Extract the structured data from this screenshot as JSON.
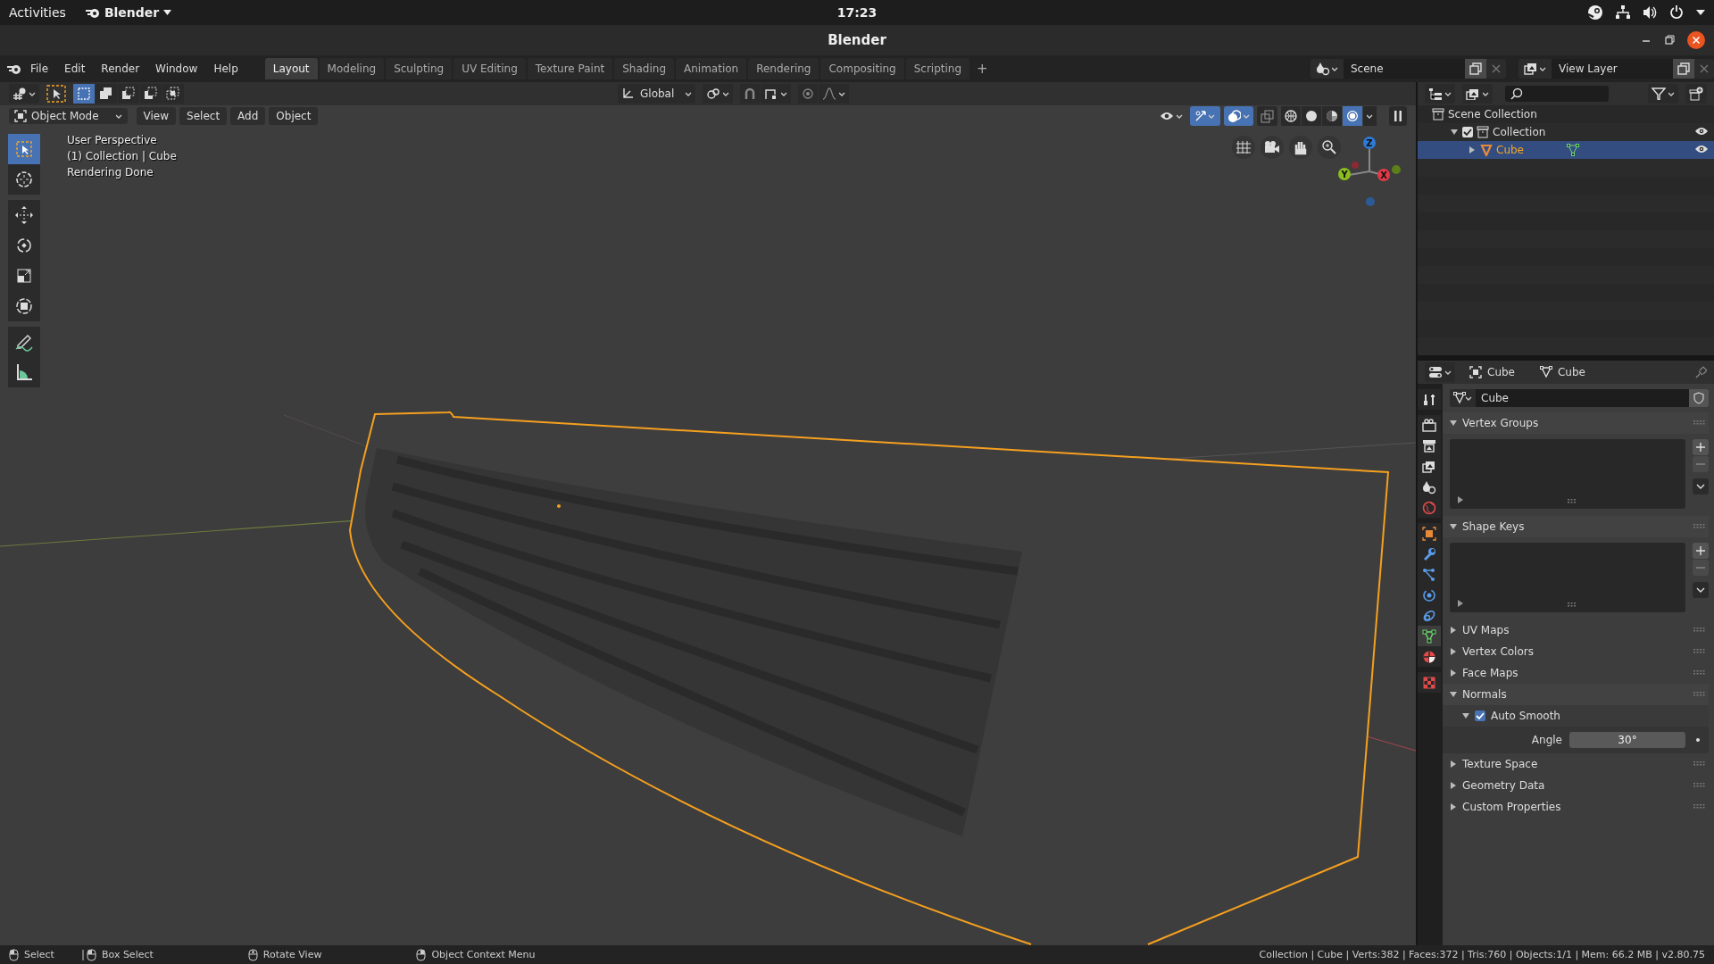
{
  "system_bar": {
    "activities": "Activities",
    "app": "Blender",
    "clock": "17:23"
  },
  "window": {
    "title": "Blender"
  },
  "menu": [
    "File",
    "Edit",
    "Render",
    "Window",
    "Help"
  ],
  "workspaces": [
    {
      "label": "Layout",
      "selected": true
    },
    {
      "label": "Modeling",
      "selected": false
    },
    {
      "label": "Sculpting",
      "selected": false
    },
    {
      "label": "UV Editing",
      "selected": false
    },
    {
      "label": "Texture Paint",
      "selected": false
    },
    {
      "label": "Shading",
      "selected": false
    },
    {
      "label": "Animation",
      "selected": false
    },
    {
      "label": "Rendering",
      "selected": false
    },
    {
      "label": "Compositing",
      "selected": false
    },
    {
      "label": "Scripting",
      "selected": false
    }
  ],
  "add_workspace": "+",
  "scene_field": "Scene",
  "view_layer_field": "View Layer",
  "tool_header": {
    "select_modes": [
      {
        "kind": "set",
        "selected": true
      },
      {
        "kind": "extend",
        "selected": false
      },
      {
        "kind": "subtract",
        "selected": false
      },
      {
        "kind": "invert",
        "selected": false
      },
      {
        "kind": "intersect",
        "selected": false
      }
    ],
    "orientation": "Global"
  },
  "viewport_header": {
    "mode": "Object Mode",
    "menus": [
      "View",
      "Select",
      "Add",
      "Object"
    ],
    "toggles": [
      {
        "kind": "gizmos",
        "on": true
      },
      {
        "kind": "overlays",
        "on": true
      },
      {
        "kind": "xray",
        "on": false
      }
    ],
    "shading": [
      {
        "kind": "wireframe",
        "selected": false
      },
      {
        "kind": "solid",
        "selected": false
      },
      {
        "kind": "material",
        "selected": false
      },
      {
        "kind": "rendered",
        "selected": true
      }
    ]
  },
  "viewport_info": [
    "User Perspective",
    "(1) Collection | Cube",
    "Rendering Done"
  ],
  "gizmo_axes": [
    "Z",
    "Y",
    "X"
  ],
  "toolbar": [
    {
      "kind": "select",
      "selected": true
    },
    {
      "kind": "cursor",
      "selected": false
    },
    {
      "kind": "move",
      "selected": false
    },
    {
      "kind": "rotate",
      "selected": false
    },
    {
      "kind": "scale",
      "selected": false
    },
    {
      "kind": "transform",
      "selected": false
    },
    {
      "kind": "annotate",
      "selected": false
    },
    {
      "kind": "measure",
      "selected": false
    }
  ],
  "outliner": {
    "tree": [
      {
        "label": "Scene Collection",
        "children": [
          {
            "label": "Collection",
            "checked": true,
            "expanded": true,
            "children": [
              {
                "label": "Cube",
                "selected": true,
                "expanded": false
              }
            ]
          }
        ]
      }
    ]
  },
  "properties": {
    "breadcrumb": [
      "Cube",
      "Cube"
    ],
    "data_name": "Cube",
    "tabs": [
      {
        "kind": "tool",
        "selected": false
      },
      {
        "kind": "render",
        "selected": false
      },
      {
        "kind": "output",
        "selected": false
      },
      {
        "kind": "view_layer",
        "selected": false
      },
      {
        "kind": "scene",
        "selected": false
      },
      {
        "kind": "world",
        "selected": false
      },
      {
        "kind": "object",
        "selected": false
      },
      {
        "kind": "modifiers",
        "selected": false
      },
      {
        "kind": "particles",
        "selected": false
      },
      {
        "kind": "physics",
        "selected": false
      },
      {
        "kind": "constraints",
        "selected": false
      },
      {
        "kind": "data",
        "selected": true
      },
      {
        "kind": "material",
        "selected": false
      },
      {
        "kind": "texture",
        "selected": false
      }
    ],
    "panels": [
      {
        "label": "Vertex Groups",
        "expanded": true,
        "kind": "list"
      },
      {
        "label": "Shape Keys",
        "expanded": true,
        "kind": "list"
      },
      {
        "label": "UV Maps",
        "expanded": false
      },
      {
        "label": "Vertex Colors",
        "expanded": false
      },
      {
        "label": "Face Maps",
        "expanded": false
      },
      {
        "label": "Normals",
        "expanded": true,
        "kind": "normals",
        "sub": {
          "label": "Auto Smooth",
          "checked": true,
          "expanded": true,
          "field_label": "Angle",
          "field_value": "30°"
        }
      },
      {
        "label": "Texture Space",
        "expanded": false
      },
      {
        "label": "Geometry Data",
        "expanded": false
      },
      {
        "label": "Custom Properties",
        "expanded": false
      }
    ]
  },
  "status_bar": {
    "hints": [
      "Select",
      "Box Select",
      "Rotate View",
      "Object Context Menu"
    ],
    "stats": "Collection | Cube | Verts:382 | Faces:372 | Tris:760 | Objects:1/1 | Mem: 66.2 MB | v2.80.75"
  }
}
